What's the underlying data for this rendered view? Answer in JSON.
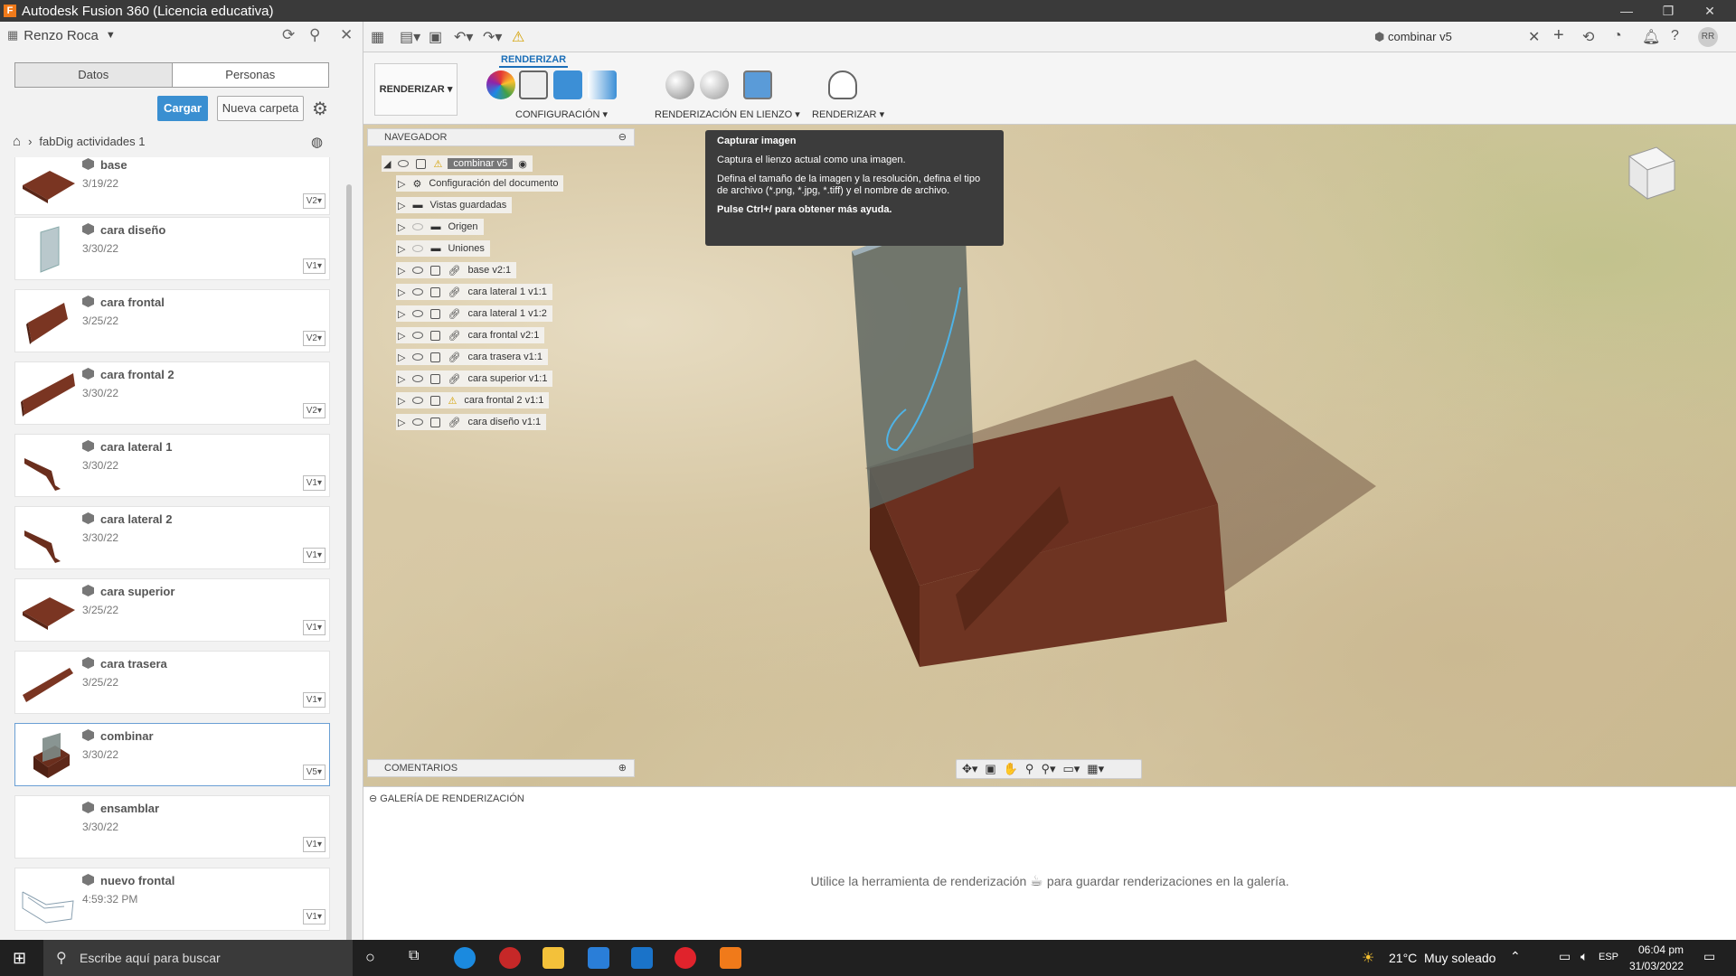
{
  "window": {
    "title": "Autodesk Fusion 360 (Licencia educativa)"
  },
  "datapanel": {
    "user": "Renzo Roca",
    "tabs": [
      "Datos",
      "Personas"
    ],
    "upload_label": "Cargar",
    "new_folder_label": "Nueva carpeta",
    "breadcrumb": "fabDig actividades 1",
    "items": [
      {
        "name": "base",
        "date": "3/19/22",
        "version": "V2"
      },
      {
        "name": "cara diseño",
        "date": "3/30/22",
        "version": "V1"
      },
      {
        "name": "cara frontal",
        "date": "3/25/22",
        "version": "V2"
      },
      {
        "name": "cara frontal 2",
        "date": "3/30/22",
        "version": "V2"
      },
      {
        "name": "cara lateral 1",
        "date": "3/30/22",
        "version": "V1"
      },
      {
        "name": "cara lateral 2",
        "date": "3/30/22",
        "version": "V1"
      },
      {
        "name": "cara superior",
        "date": "3/25/22",
        "version": "V1"
      },
      {
        "name": "cara trasera",
        "date": "3/25/22",
        "version": "V1"
      },
      {
        "name": "combinar",
        "date": "3/30/22",
        "version": "V5"
      },
      {
        "name": "ensamblar",
        "date": "3/30/22",
        "version": "V1"
      },
      {
        "name": "nuevo frontal",
        "date": "4:59:32 PM",
        "version": "V1"
      }
    ]
  },
  "document": {
    "tab_title": "combinar v5",
    "user_initials": "RR"
  },
  "ribbon": {
    "active_tab": "RENDERIZAR",
    "workspace": "RENDERIZAR",
    "groups": [
      "CONFIGURACIÓN",
      "RENDERIZACIÓN EN LIENZO",
      "RENDERIZAR"
    ]
  },
  "navigator": {
    "title": "NAVEGADOR",
    "root": "combinar v5",
    "items": [
      "Configuración del documento",
      "Vistas guardadas",
      "Origen",
      "Uniones",
      "base v2:1",
      "cara lateral 1 v1:1",
      "cara lateral 1 v1:2",
      "cara frontal v2:1",
      "cara trasera v1:1",
      "cara superior v1:1",
      "cara frontal 2 v1:1",
      "cara diseño v1:1"
    ]
  },
  "tooltip": {
    "title": "Capturar imagen",
    "line1": "Captura el lienzo actual como una imagen.",
    "line2": "Defina el tamaño de la imagen y la resolución, defina el tipo de archivo (*.png, *.jpg, *.tiff) y el nombre de archivo.",
    "line3": "Pulse Ctrl+/ para obtener más ayuda."
  },
  "comments": {
    "title": "COMENTARIOS"
  },
  "gallery": {
    "title": "GALERÍA DE RENDERIZACIÓN",
    "message_before": "Utilice la herramienta de renderización",
    "message_after": "para guardar renderizaciones en la galería."
  },
  "taskbar": {
    "search_placeholder": "Escribe aquí para buscar",
    "weather": "21°C  Muy soleado",
    "lang": "ESP",
    "time": "06:04 pm",
    "date": "31/03/2022"
  }
}
